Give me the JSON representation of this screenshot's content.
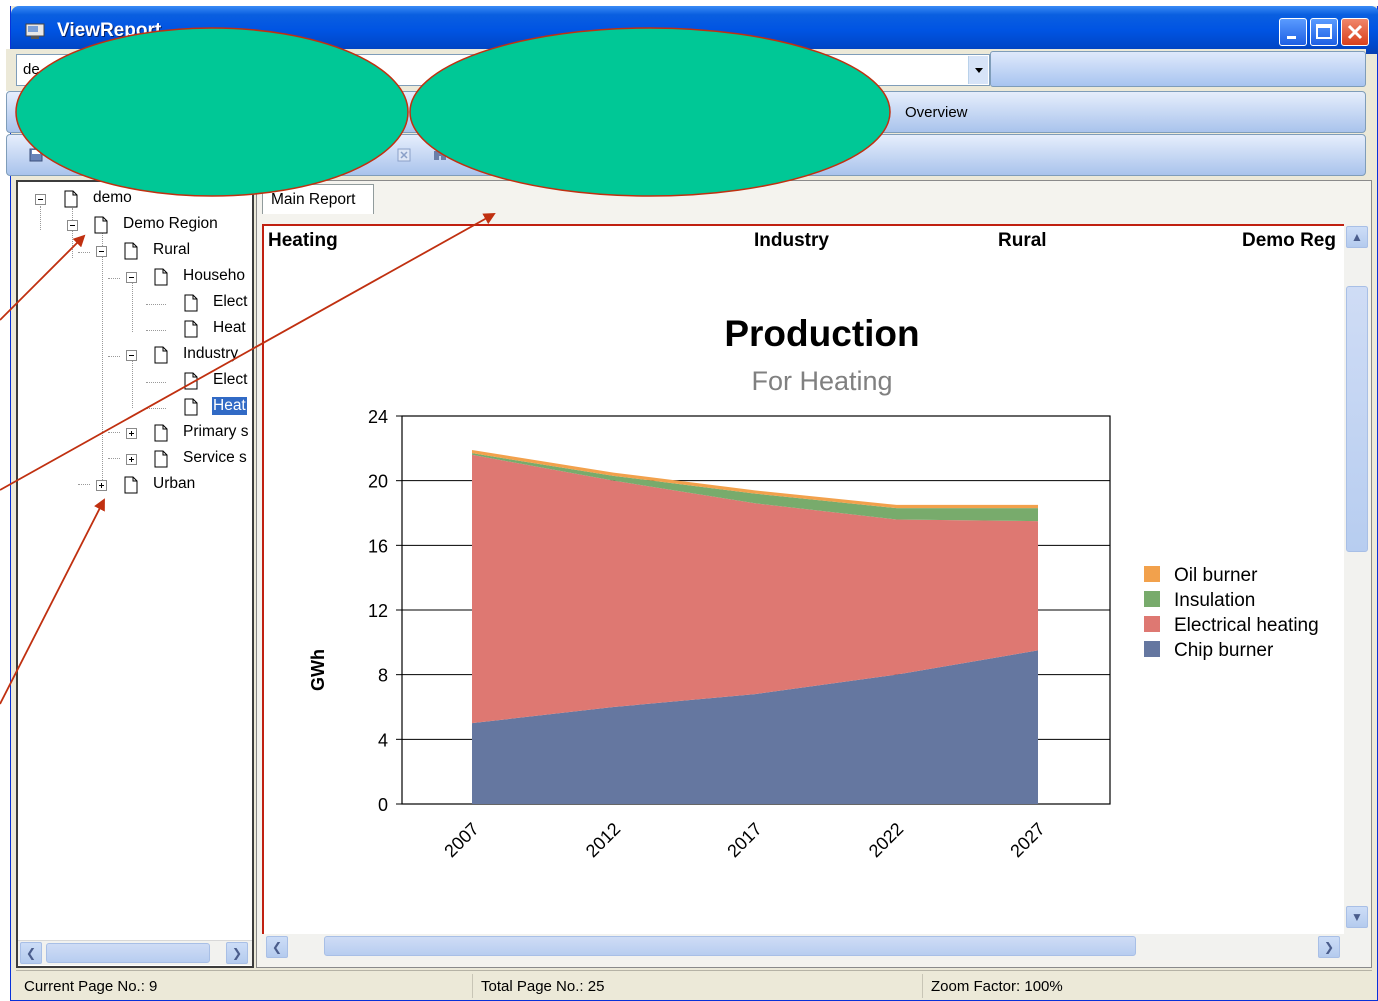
{
  "window": {
    "title": "ViewReport",
    "combo_value": "de"
  },
  "tabs": {
    "overview_label": "Overview"
  },
  "tree": {
    "nodes": [
      {
        "label": "demo"
      },
      {
        "label": "Demo Region"
      },
      {
        "label": "Rural"
      },
      {
        "label": "Househo"
      },
      {
        "label": "Elect"
      },
      {
        "label": "Heat"
      },
      {
        "label": "Industry"
      },
      {
        "label": "Elect"
      },
      {
        "label": "Heat"
      },
      {
        "label": "Primary s"
      },
      {
        "label": "Service s"
      },
      {
        "label": "Urban"
      }
    ]
  },
  "report": {
    "tab_label": "Main Report",
    "header": {
      "col1": "Heating",
      "col2": "Industry",
      "col3": "Rural",
      "col4": "Demo Reg"
    }
  },
  "chart_data": {
    "type": "area",
    "stacked": true,
    "title": "Production",
    "subtitle": "For Heating",
    "ylabel": "GWh",
    "xlabel": "",
    "x": [
      2007,
      2012,
      2017,
      2022,
      2027
    ],
    "x_tick_labels": [
      "2007",
      "2012",
      "2017",
      "2022",
      "2027"
    ],
    "ylim": [
      0,
      24
    ],
    "y_ticks": [
      0,
      4,
      8,
      12,
      16,
      20,
      24
    ],
    "y_tick_labels": [
      "0",
      "4",
      "8",
      "12",
      "16",
      "20",
      "24"
    ],
    "grid": true,
    "legend_position": "right",
    "series": [
      {
        "name": "Chip burner",
        "color": "#6577a0",
        "values": [
          5.0,
          6.0,
          6.8,
          8.0,
          9.5
        ]
      },
      {
        "name": "Electrical heating",
        "color": "#de7872",
        "values": [
          16.6,
          14.0,
          11.8,
          9.6,
          8.0
        ]
      },
      {
        "name": "Insulation",
        "color": "#78ab6c",
        "values": [
          0.1,
          0.3,
          0.6,
          0.7,
          0.8
        ]
      },
      {
        "name": "Oil burner",
        "color": "#f2a14c",
        "values": [
          0.2,
          0.2,
          0.2,
          0.2,
          0.2
        ]
      }
    ],
    "legend_order": [
      "Oil burner",
      "Insulation",
      "Electrical heating",
      "Chip burner"
    ]
  },
  "status": {
    "current_page": "Current Page No.: 9",
    "total_pages": "Total Page No.: 25",
    "zoom": "Zoom Factor: 100%"
  },
  "colors": {
    "titlebar": "#0054e3",
    "annotation_fill": "#00c896",
    "annotation_stroke": "#c03010",
    "selection": "#316ac5"
  },
  "icons": {
    "title": "app-window-icon",
    "minimize": "minimize-icon",
    "maximize": "maximize-icon",
    "close": "close-icon",
    "tree_doc": "document-icon"
  }
}
